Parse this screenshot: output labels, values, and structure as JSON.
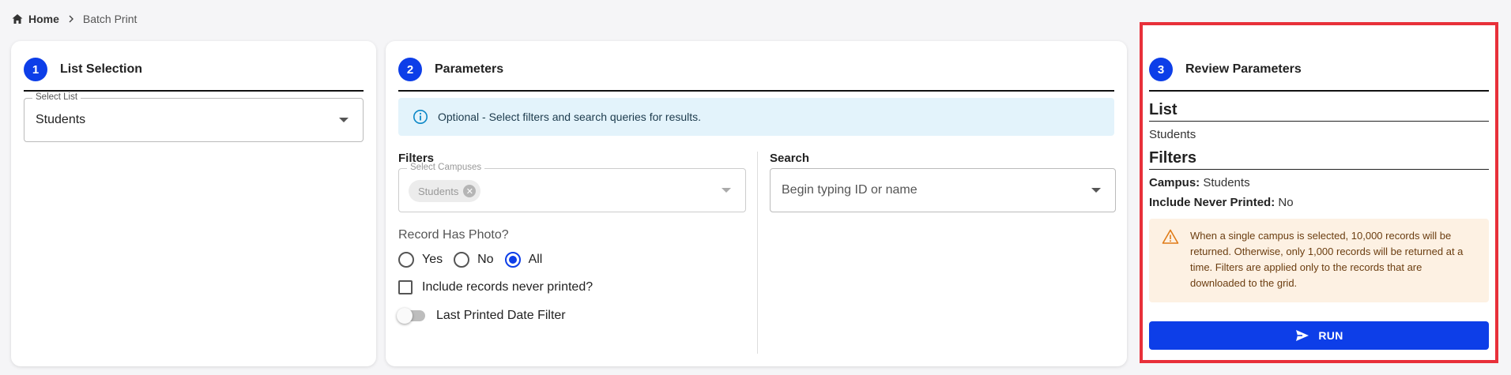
{
  "breadcrumb": {
    "home": "Home",
    "current": "Batch Print"
  },
  "step1": {
    "number": "1",
    "title": "List Selection",
    "select_label": "Select List",
    "select_value": "Students"
  },
  "step2": {
    "number": "2",
    "title": "Parameters",
    "info_text": "Optional - Select filters and search queries for results.",
    "filters_label": "Filters",
    "campuses_label": "Select Campuses",
    "campus_chip": "Students",
    "photo_question": "Record Has Photo?",
    "photo_options": {
      "yes": "Yes",
      "no": "No",
      "all": "All"
    },
    "photo_selected": "All",
    "never_printed_label": "Include records never printed?",
    "last_printed_label": "Last Printed Date Filter",
    "search_label": "Search",
    "search_placeholder": "Begin typing ID or name"
  },
  "step3": {
    "number": "3",
    "title": "Review Parameters",
    "list_heading": "List",
    "list_value": "Students",
    "filters_heading": "Filters",
    "campus_key": "Campus:",
    "campus_value": "Students",
    "never_printed_key": "Include Never Printed:",
    "never_printed_value": "No",
    "warning_text": "When a single campus is selected, 10,000 records will be returned. Otherwise, only 1,000 records will be returned at a time. Filters are applied only to the records that are downloaded to the grid.",
    "run_label": "RUN"
  },
  "colors": {
    "accent": "#0d3ee8",
    "highlight_border": "#e8303a",
    "info_bg": "#e3f3fb",
    "warning_bg": "#fdf1e3",
    "warning_icon": "#e07b17"
  }
}
